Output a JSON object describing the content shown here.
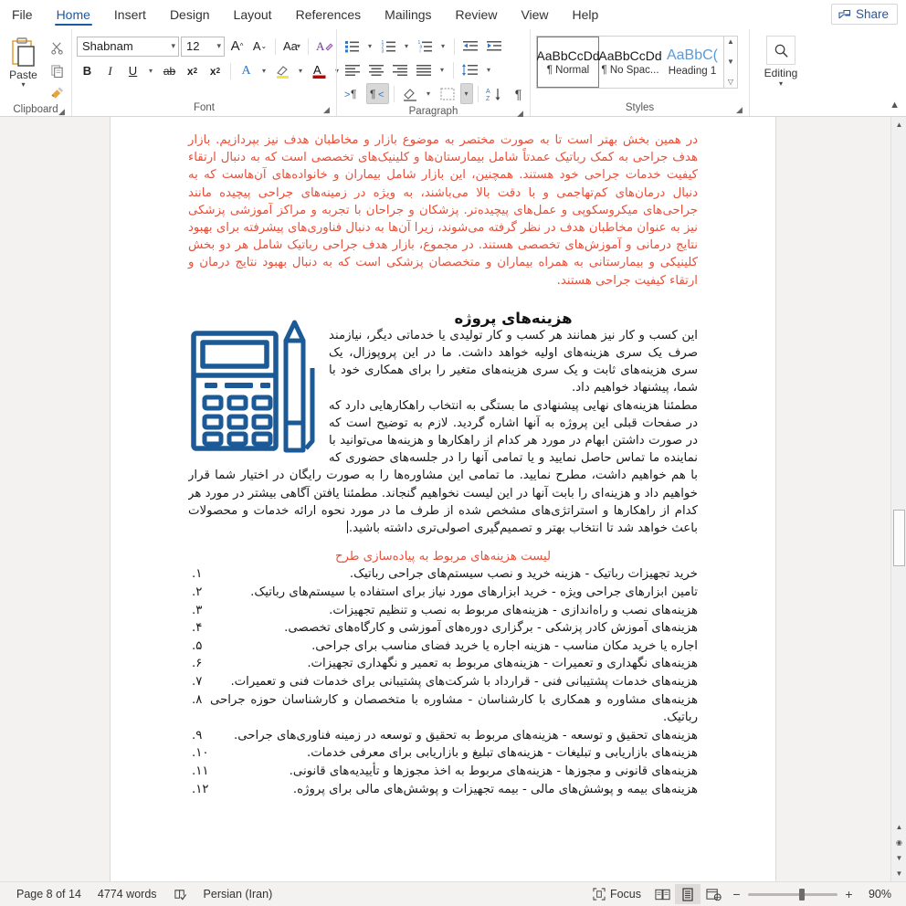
{
  "app": {
    "share_label": "Share",
    "share_icon": "share-icon"
  },
  "tabs": [
    {
      "label": "File",
      "name": "tab-file",
      "active": false
    },
    {
      "label": "Home",
      "name": "tab-home",
      "active": true
    },
    {
      "label": "Insert",
      "name": "tab-insert",
      "active": false
    },
    {
      "label": "Design",
      "name": "tab-design",
      "active": false
    },
    {
      "label": "Layout",
      "name": "tab-layout",
      "active": false
    },
    {
      "label": "References",
      "name": "tab-references",
      "active": false
    },
    {
      "label": "Mailings",
      "name": "tab-mailings",
      "active": false
    },
    {
      "label": "Review",
      "name": "tab-review",
      "active": false
    },
    {
      "label": "View",
      "name": "tab-view",
      "active": false
    },
    {
      "label": "Help",
      "name": "tab-help",
      "active": false
    }
  ],
  "ribbon": {
    "clipboard": {
      "group_label": "Clipboard",
      "paste_label": "Paste",
      "icons": [
        "paste-icon",
        "cut-scissors-icon",
        "copy-icon",
        "format-painter-icon"
      ]
    },
    "font": {
      "group_label": "Font",
      "font_name": "Shabnam",
      "font_size": "12",
      "buttons": {
        "grow_font": "A",
        "shrink_font": "A",
        "change_case": "Aa",
        "clear_formatting": "A",
        "bold": "B",
        "italic": "I",
        "underline": "U",
        "strikethrough": "ab",
        "subscript": "x",
        "subscript_sub": "2",
        "superscript": "x",
        "superscript_sup": "2",
        "text_effects": "A",
        "highlight": "A",
        "font_color": "A"
      }
    },
    "paragraph": {
      "group_label": "Paragraph"
    },
    "styles": {
      "group_label": "Styles",
      "items": [
        {
          "preview": "AaBbCcDd",
          "name": "¶ Normal",
          "selected": true
        },
        {
          "preview": "AaBbCcDd",
          "name": "¶ No Spac...",
          "selected": false
        },
        {
          "preview": "AaBbC(",
          "name": "Heading 1",
          "selected": false
        }
      ]
    },
    "editing": {
      "group_label": "Editing",
      "label": "Editing",
      "icon": "search-magnifier-icon"
    }
  },
  "document": {
    "paragraph_red_intro": "در همین بخش بهتر است تا به صورت مختصر به موضوع بازار و مخاطبان هدف نیز بپردازیم. بازار هدف جراحی به کمک رباتیک عمدتاً شامل بیمارستان‌ها و کلینیک‌های تخصصی است که به دنبال ارتقاء کیفیت خدمات جراحی خود هستند. همچنین، این بازار شامل بیماران و خانواده‌های آن‌هاست که به دنبال درمان‌های کم‌تهاجمی و با دقت بالا می‌باشند، به ویژه در زمینه‌های جراحی پیچیده مانند جراحی‌های میکروسکوپی و عمل‌های پیچیده‌تر. پزشکان و جراحان با تجربه و مراکز آموزشی پزشکی نیز به عنوان مخاطبان هدف در نظر گرفته می‌شوند، زیرا آن‌ها به دنبال فناوری‌های پیشرفته برای بهبود نتایج درمانی و آموزش‌های تخصصی هستند. در مجموع، بازار هدف جراحی رباتیک شامل هر دو بخش کلینیکی و بیمارستانی به همراه بیماران و متخصصان پزشکی است که به دنبال بهبود نتایج درمان و ارتقاء کیفیت جراحی هستند.",
    "heading_costs": "هزینه‌های پروژه",
    "paragraph_costs_1": "این کسب و کار نیز همانند هر کسب و کار تولیدی یا خدماتی دیگر، نیازمند صرف یک سری هزینه‌های اولیه خواهد داشت. ما در این پروپوزال، یک سری هزینه‌های ثابت و یک سری هزینه‌های متغیر را برای همکاری خود با شما، پیشنهاد خواهیم داد.",
    "paragraph_costs_2": "مطمئنا هزینه‌های نهایی پیشنهادی ما بستگی به انتخاب راهکارهایی دارد که در صفحات قبلی این پروژه به آنها اشاره گردید. لازم به توضیح است که در صورت داشتن ابهام در مورد هر کدام از راهکارها و هزینه‌ها می‌توانید با نماینده ما تماس حاصل نمایید و یا تمامی آنها را در جلسه‌های حضوری که با هم خواهیم داشت، مطرح نمایید. ما تمامی این مشاوره‌ها را به صورت رایگان در اختیار شما قرار خواهیم داد و هزینه‌ای را بابت آنها در این لیست نخواهیم گنجاند. مطمئنا یافتن آگاهی بیشتر در مورد هر کدام از راهکارها و استراتژی‌های مشخص شده از طرف ما در مورد نحوه ارائه خدمات و محصولات باعث خواهد شد تا انتخاب بهتر و تصمیم‌گیری اصولی‌تری داشته باشید.",
    "subheading_red": "لیست هزینه‌های مربوط به پیاده‌سازی طرح",
    "image_alt": "calculator-and-pencil-illustration",
    "image_color": "#1b5a96",
    "list": [
      {
        "num": "۱.",
        "text": "خرید تجهیزات رباتیک - هزینه خرید و نصب سیستم‌های جراحی رباتیک."
      },
      {
        "num": "۲.",
        "text": "تامین ابزارهای جراحی ویژه - خرید ابزارهای مورد نیاز برای استفاده با سیستم‌های رباتیک."
      },
      {
        "num": "۳.",
        "text": "هزینه‌های نصب و راه‌اندازی - هزینه‌های مربوط به نصب و تنظیم تجهیزات."
      },
      {
        "num": "۴.",
        "text": "هزینه‌های آموزش کادر پزشکی - برگزاری دوره‌های آموزشی و کارگاه‌های تخصصی."
      },
      {
        "num": "۵.",
        "text": "اجاره یا خرید مکان مناسب - هزینه اجاره یا خرید فضای مناسب برای جراحی."
      },
      {
        "num": "۶.",
        "text": "هزینه‌های نگهداری و تعمیرات - هزینه‌های مربوط به تعمیر و نگهداری تجهیزات."
      },
      {
        "num": "۷.",
        "text": "هزینه‌های خدمات پشتیبانی فنی - قرارداد با شرکت‌های پشتیبانی برای خدمات فنی و تعمیرات."
      },
      {
        "num": "۸.",
        "text": "هزینه‌های مشاوره و همکاری با کارشناسان - مشاوره با متخصصان و کارشناسان حوزه جراحی رباتیک."
      },
      {
        "num": "۹.",
        "text": "هزینه‌های تحقیق و توسعه - هزینه‌های مربوط به تحقیق و توسعه در زمینه فناوری‌های جراحی."
      },
      {
        "num": "۱۰.",
        "text": "هزینه‌های بازاریابی و تبلیغات - هزینه‌های تبلیغ و بازاریابی برای معرفی خدمات."
      },
      {
        "num": "۱۱.",
        "text": "هزینه‌های قانونی و مجوزها - هزینه‌های مربوط به اخذ مجوزها و تأییدیه‌های قانونی."
      },
      {
        "num": "۱۲.",
        "text": "هزینه‌های بیمه و پوشش‌های مالی - بیمه تجهیزات و پوشش‌های مالی برای پروژه."
      }
    ]
  },
  "status": {
    "page": "Page 8 of 14",
    "words": "4774 words",
    "proofing_icon": "proofing-errors-icon",
    "language": "Persian (Iran)",
    "focus_label": "Focus",
    "focus_icon": "focus-mode-icon",
    "view_read_icon": "read-mode-icon",
    "view_print_icon": "print-layout-icon",
    "view_web_icon": "web-layout-icon",
    "zoom_out": "−",
    "zoom_in": "+",
    "zoom_percent": "90%"
  }
}
